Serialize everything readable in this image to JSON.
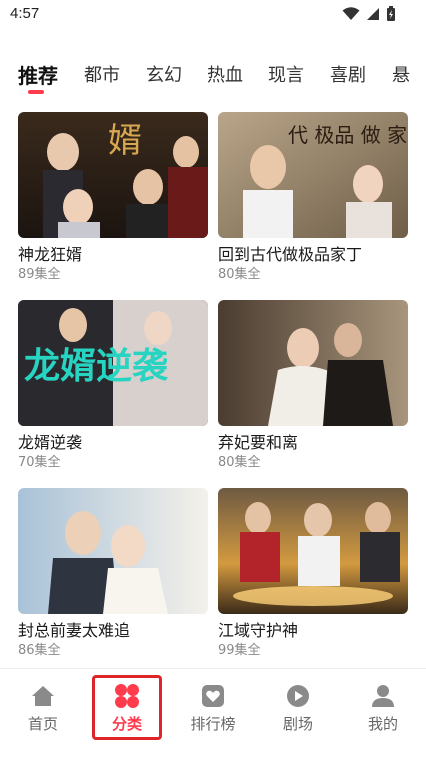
{
  "status_bar": {
    "time": "4:57"
  },
  "tabs": [
    {
      "label": "推荐",
      "active": true
    },
    {
      "label": "都市"
    },
    {
      "label": "玄幻"
    },
    {
      "label": "热血"
    },
    {
      "label": "现言"
    },
    {
      "label": "喜剧"
    },
    {
      "label": "悬"
    }
  ],
  "dramas": [
    {
      "title": "神龙狂婿",
      "episodes": "89集全",
      "thumb_text": "婿"
    },
    {
      "title": "回到古代做极品家丁",
      "episodes": "80集全",
      "thumb_text": "代 极品 做 家 丁"
    },
    {
      "title": "龙婿逆袭",
      "episodes": "70集全",
      "thumb_text": "龙婿逆袭"
    },
    {
      "title": "弃妃要和离",
      "episodes": "80集全",
      "thumb_text": ""
    },
    {
      "title": "封总前妻太难追",
      "episodes": "86集全",
      "thumb_text": ""
    },
    {
      "title": "江域守护神",
      "episodes": "99集全",
      "thumb_text": ""
    }
  ],
  "bottom_nav": [
    {
      "label": "首页",
      "icon": "home-icon"
    },
    {
      "label": "分类",
      "icon": "category-icon",
      "active": true
    },
    {
      "label": "排行榜",
      "icon": "ranking-icon"
    },
    {
      "label": "剧场",
      "icon": "theater-icon"
    },
    {
      "label": "我的",
      "icon": "profile-icon"
    }
  ],
  "colors": {
    "accent": "#ff3b4e",
    "highlight_box": "#e0252a"
  }
}
